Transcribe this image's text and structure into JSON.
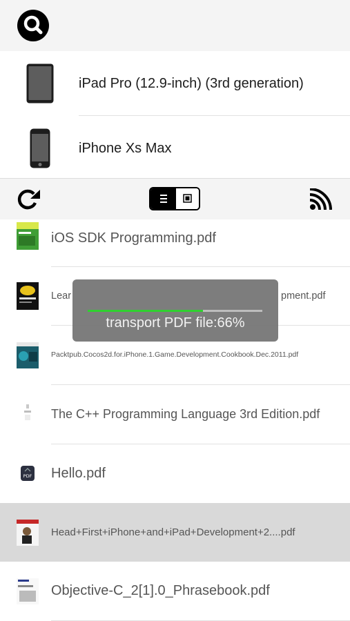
{
  "devices": [
    {
      "label": "iPad Pro (12.9-inch) (3rd generation)",
      "icon": "ipad-icon"
    },
    {
      "label": "iPhone Xs Max",
      "icon": "iphone-icon"
    }
  ],
  "toolbar": {
    "refresh_icon": "refresh-icon",
    "view_toggle": {
      "options": [
        "list",
        "grid"
      ],
      "selected": "list"
    },
    "cast_icon": "cast-icon"
  },
  "files": [
    {
      "name": "iOS SDK Programming.pdf"
    },
    {
      "name": "Learning iPhone Game Development.pdf",
      "visible_left": "Lear",
      "visible_right": "pment.pdf"
    },
    {
      "name": "Packtpub.Cocos2d.for.iPhone.1.Game.Development.Cookbook.Dec.2011.pdf"
    },
    {
      "name": "The C++ Programming Language 3rd Edition.pdf"
    },
    {
      "name": "Hello.pdf"
    },
    {
      "name": "Head+First+iPhone+and+iPad+Development+2....pdf",
      "selected": true
    },
    {
      "name": "Objective-C_2[1].0_Phrasebook.pdf"
    }
  ],
  "toast": {
    "text": "transport PDF file:66%",
    "progress": 0.66
  },
  "colors": {
    "accent_progress": "#2fd12f",
    "toolbar_bg": "#f4f4f4",
    "selected_row": "#d9d9d9"
  }
}
